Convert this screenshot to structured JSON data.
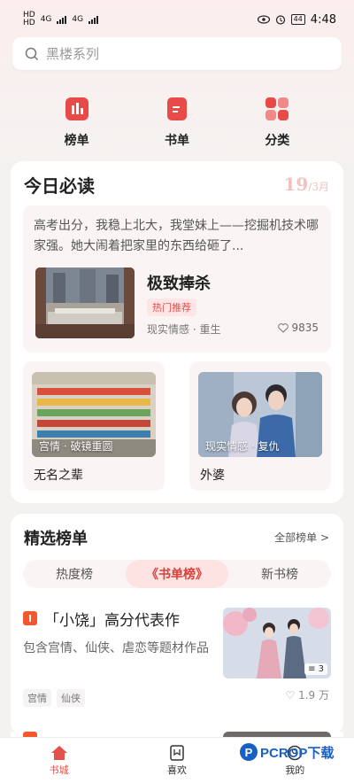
{
  "status_bar": {
    "net1": "HD",
    "net2": "HD",
    "sig1": "4G",
    "sig2": "4G",
    "battery": "44",
    "time": "4:48"
  },
  "search": {
    "placeholder": "黑楼系列"
  },
  "quick_nav": [
    {
      "label": "榜单",
      "icon": "chart-bars-icon"
    },
    {
      "label": "书单",
      "icon": "booklist-icon"
    },
    {
      "label": "分类",
      "icon": "category-grid-icon"
    }
  ],
  "daily": {
    "title": "今日必读",
    "date_day": "19",
    "date_month": "/3月",
    "feature": {
      "excerpt": "高考出分，我稳上北大，我堂妹上——挖掘机技术哪家强。她大闹着把家里的东西给砸了...",
      "title": "极致捧杀",
      "tag": "热门推荐",
      "genre": "现实情感 · 重生",
      "likes": "9835"
    },
    "books": [
      {
        "tag": "宫情 · 破镜重圆",
        "title": "无名之辈"
      },
      {
        "tag": "现实情感 · 复仇",
        "title": "外婆"
      }
    ]
  },
  "ranking": {
    "title": "精选榜单",
    "all_label": "全部榜单 >",
    "tabs": [
      "热度榜",
      "书单榜",
      "新书榜"
    ],
    "active_tab": 1,
    "item": {
      "title": "「小饶」高分代表作",
      "desc": "包含宫情、仙侠、虐恋等题材作品",
      "chips": [
        "宫情",
        "仙侠"
      ],
      "cover_count": "3",
      "likes": "1.9 万"
    }
  },
  "tabbar": [
    {
      "label": "书城",
      "icon": "home-icon",
      "active": true
    },
    {
      "label": "喜欢",
      "icon": "bookmark-icon",
      "active": false
    },
    {
      "label": "我的",
      "icon": "profile-icon",
      "active": false
    }
  ],
  "watermark": {
    "p": "P",
    "text": "PCROP下载"
  },
  "colors": {
    "accent": "#e2504c",
    "brand_red": "#e84a48",
    "date": "#f1c2c0"
  }
}
